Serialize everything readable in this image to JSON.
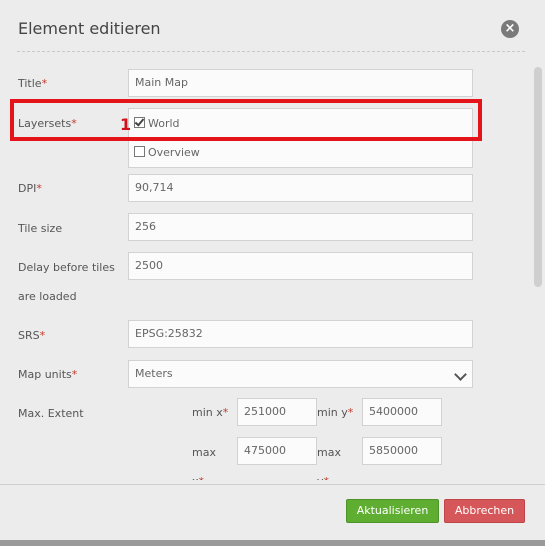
{
  "dialog": {
    "title": "Element editieren"
  },
  "form": {
    "title": {
      "label": "Title",
      "required_mark": "*",
      "value": "Main Map"
    },
    "layersets": {
      "label": "Layersets",
      "required_mark": "*",
      "options": [
        {
          "label": "World",
          "checked": true
        },
        {
          "label": "Overview",
          "checked": false
        }
      ]
    },
    "dpi": {
      "label": "DPI",
      "required_mark": "*",
      "value": "90,714"
    },
    "tile_size": {
      "label": "Tile size",
      "value": "256"
    },
    "delay": {
      "label_line1": "Delay before tiles",
      "label_line2": "are loaded",
      "value": "2500"
    },
    "srs": {
      "label": "SRS",
      "required_mark": "*",
      "value": "EPSG:25832"
    },
    "map_units": {
      "label": "Map units",
      "required_mark": "*",
      "value": "Meters"
    },
    "max_extent": {
      "label": "Max. Extent",
      "min_x_label": "min x",
      "min_x": "251000",
      "min_y_label": "min y",
      "min_y": "5400000",
      "max_x_label": "max",
      "max_x_label2": "x",
      "max_x": "475000",
      "max_y_label": "max",
      "max_y_label2": "y",
      "max_y": "5850000",
      "required_mark": "*"
    }
  },
  "annotation": {
    "step_number": "1",
    "highlight_color": "#e5141a"
  },
  "buttons": {
    "update": "Aktualisieren",
    "cancel": "Abbrechen"
  },
  "colors": {
    "update_button": "#5fae32",
    "cancel_button": "#d6575a",
    "required": "#c0392b"
  }
}
